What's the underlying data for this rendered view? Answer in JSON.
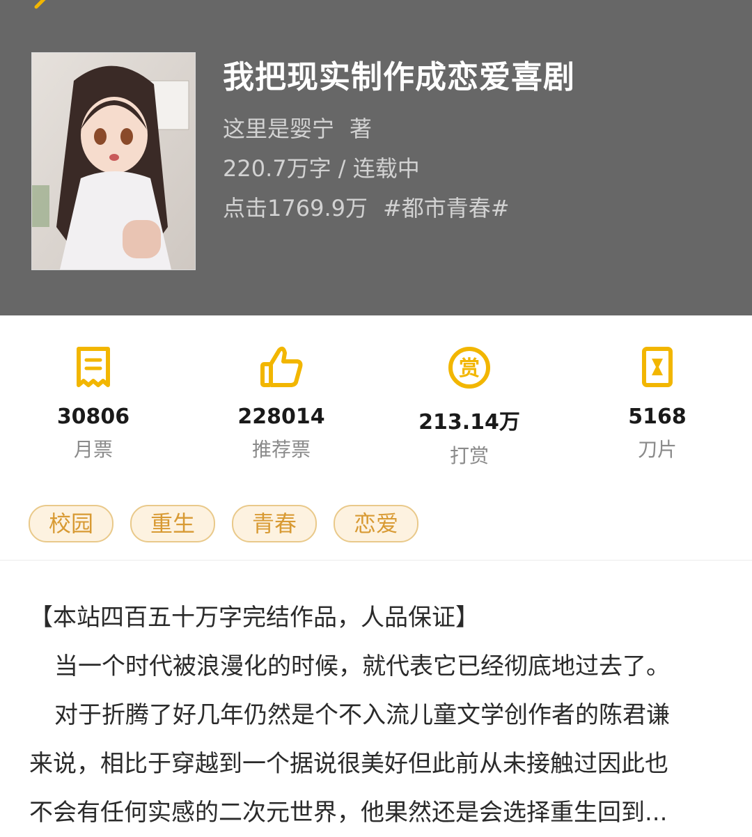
{
  "book": {
    "title": "我把现实制作成恋爱喜剧",
    "author": "这里是婴宁",
    "author_suffix": "著",
    "word_count": "220.7万字",
    "separator": "/",
    "status": "连载中",
    "clicks": "点击1769.9万",
    "genre": "#都市青春#"
  },
  "stats": [
    {
      "value": "30806",
      "label": "月票",
      "icon": "ticket-icon"
    },
    {
      "value": "228014",
      "label": "推荐票",
      "icon": "thumbs-up-icon"
    },
    {
      "value": "213.14万",
      "label": "打赏",
      "icon": "reward-coin-icon",
      "icon_text": "赏"
    },
    {
      "value": "5168",
      "label": "刀片",
      "icon": "blade-icon"
    }
  ],
  "tags": [
    "校园",
    "重生",
    "青春",
    "恋爱"
  ],
  "description": [
    "【本站四百五十万字完结作品，人品保证】",
    "当一个时代被浪漫化的时候，就代表它已经彻底地过去了。",
    "对于折腾了好几年仍然是个不入流儿童文学创作者的陈君谦",
    "来说，相比于穿越到一个据说很美好但此前从未接触过因此也",
    "不会有任何实感的二次元世界，他果然还是会选择重生回到..."
  ],
  "colors": {
    "header_bg": "#676767",
    "accent": "#f2b600",
    "tag_text": "#d89a33",
    "tag_border": "#e9c98a",
    "tag_bg": "#fdf2e0"
  }
}
